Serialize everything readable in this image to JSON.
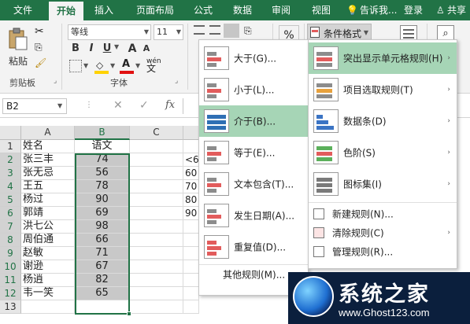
{
  "ribbon_tabs": [
    "文件",
    "开始",
    "插入",
    "页面布局",
    "公式",
    "数据",
    "审阅",
    "视图"
  ],
  "active_tab": "开始",
  "tell_me": "告诉我...",
  "login": "登录",
  "share": "共享",
  "clipboard": {
    "paste": "粘贴",
    "group_label": "剪贴板"
  },
  "font": {
    "name": "等线",
    "size": "11",
    "group_label": "字体",
    "bold": "B",
    "italic": "I",
    "underline": "U",
    "grow": "A",
    "shrink": "A",
    "font_color": "A",
    "wen": "wén"
  },
  "number_format": "%",
  "conditional_format": "条件格式",
  "formula_bar": {
    "name_box": "B2",
    "fx": "fx",
    "cancel": "✕",
    "confirm": "✓"
  },
  "columns": [
    "A",
    "B",
    "C"
  ],
  "rows": [
    "1",
    "2",
    "3",
    "4",
    "5",
    "6",
    "7",
    "8",
    "9",
    "10",
    "11",
    "12",
    "13"
  ],
  "table": {
    "header": [
      "姓名",
      "语文"
    ],
    "rows": [
      [
        "张三丰",
        "74"
      ],
      [
        "张无忌",
        "56"
      ],
      [
        "王五",
        "78"
      ],
      [
        "杨过",
        "90"
      ],
      [
        "郭靖",
        "69"
      ],
      [
        "洪七公",
        "98"
      ],
      [
        "周伯通",
        "66"
      ],
      [
        "赵敏",
        "71"
      ],
      [
        "谢逊",
        "67"
      ],
      [
        "杨逍",
        "82"
      ],
      [
        "韦一笑",
        "65"
      ]
    ]
  },
  "partial_cells": [
    "<6",
    "60",
    "70",
    "80",
    "90"
  ],
  "submenu_highlight_rules": [
    "大于(G)...",
    "小于(L)...",
    "介于(B)...",
    "等于(E)...",
    "文本包含(T)...",
    "发生日期(A)...",
    "重复值(D)..."
  ],
  "submenu_more_rules": "其他规则(M)...",
  "highlighted_item": "介于(B)...",
  "cond_format_menu": [
    {
      "label": "突出显示单元格规则(H)",
      "arrow": "›"
    },
    {
      "label": "项目选取规则(T)",
      "arrow": "›"
    },
    {
      "label": "数据条(D)",
      "arrow": "›"
    },
    {
      "label": "色阶(S)",
      "arrow": "›"
    },
    {
      "label": "图标集(I)",
      "arrow": "›"
    }
  ],
  "cond_format_actions": [
    {
      "label": "新建规则(N)..."
    },
    {
      "label": "清除规则(C)",
      "arrow": "›"
    },
    {
      "label": "管理规则(R)..."
    }
  ],
  "watermark": {
    "title": "系统之家",
    "url": "www.Ghost123.com"
  },
  "colors": {
    "excel_green": "#217346",
    "highlight": "#a6d5b6",
    "selection_fill": "#c8c8c8"
  }
}
